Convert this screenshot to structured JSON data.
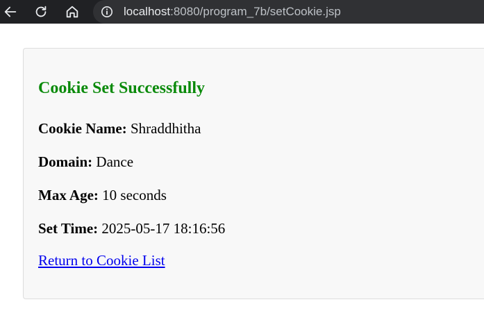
{
  "browser": {
    "url_host": "localhost",
    "url_path": ":8080/program_7b/setCookie.jsp",
    "icons": [
      "back-icon",
      "reload-icon",
      "home-icon",
      "info-icon"
    ]
  },
  "page": {
    "heading": "Cookie Set Successfully",
    "heading_color": "#0a8a0a",
    "fields": [
      {
        "label": "Cookie Name:",
        "value": "Shraddhitha"
      },
      {
        "label": "Domain:",
        "value": "Dance"
      },
      {
        "label": "Max Age:",
        "value": "10 seconds"
      },
      {
        "label": "Set Time:",
        "value": "2025-05-17 18:16:56"
      }
    ],
    "link_text": "Return to Cookie List",
    "link_color": "#0000ee"
  }
}
